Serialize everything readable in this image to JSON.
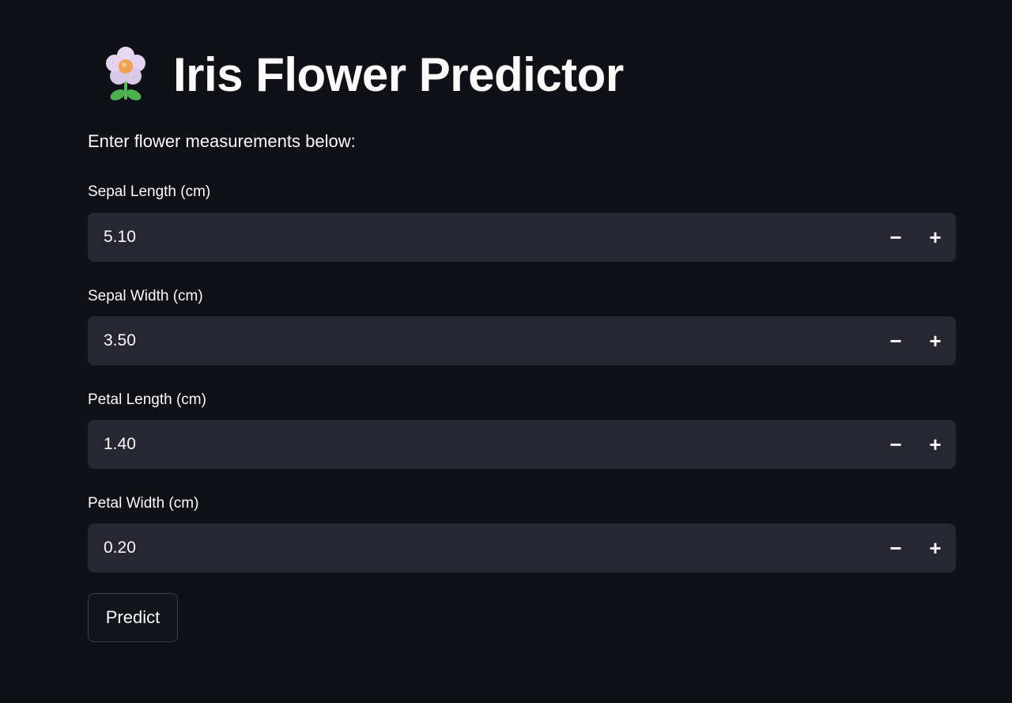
{
  "header": {
    "icon": "flower-icon",
    "title": "Iris Flower Predictor"
  },
  "subtitle": "Enter flower measurements below:",
  "fields": [
    {
      "label": "Sepal Length (cm)",
      "value": "5.10"
    },
    {
      "label": "Sepal Width (cm)",
      "value": "3.50"
    },
    {
      "label": "Petal Length (cm)",
      "value": "1.40"
    },
    {
      "label": "Petal Width (cm)",
      "value": "0.20"
    }
  ],
  "stepper": {
    "minus": "−",
    "plus": "+"
  },
  "predict_button": "Predict",
  "colors": {
    "background": "#0f1117",
    "input_bg": "#262730",
    "text": "#fafafa"
  }
}
